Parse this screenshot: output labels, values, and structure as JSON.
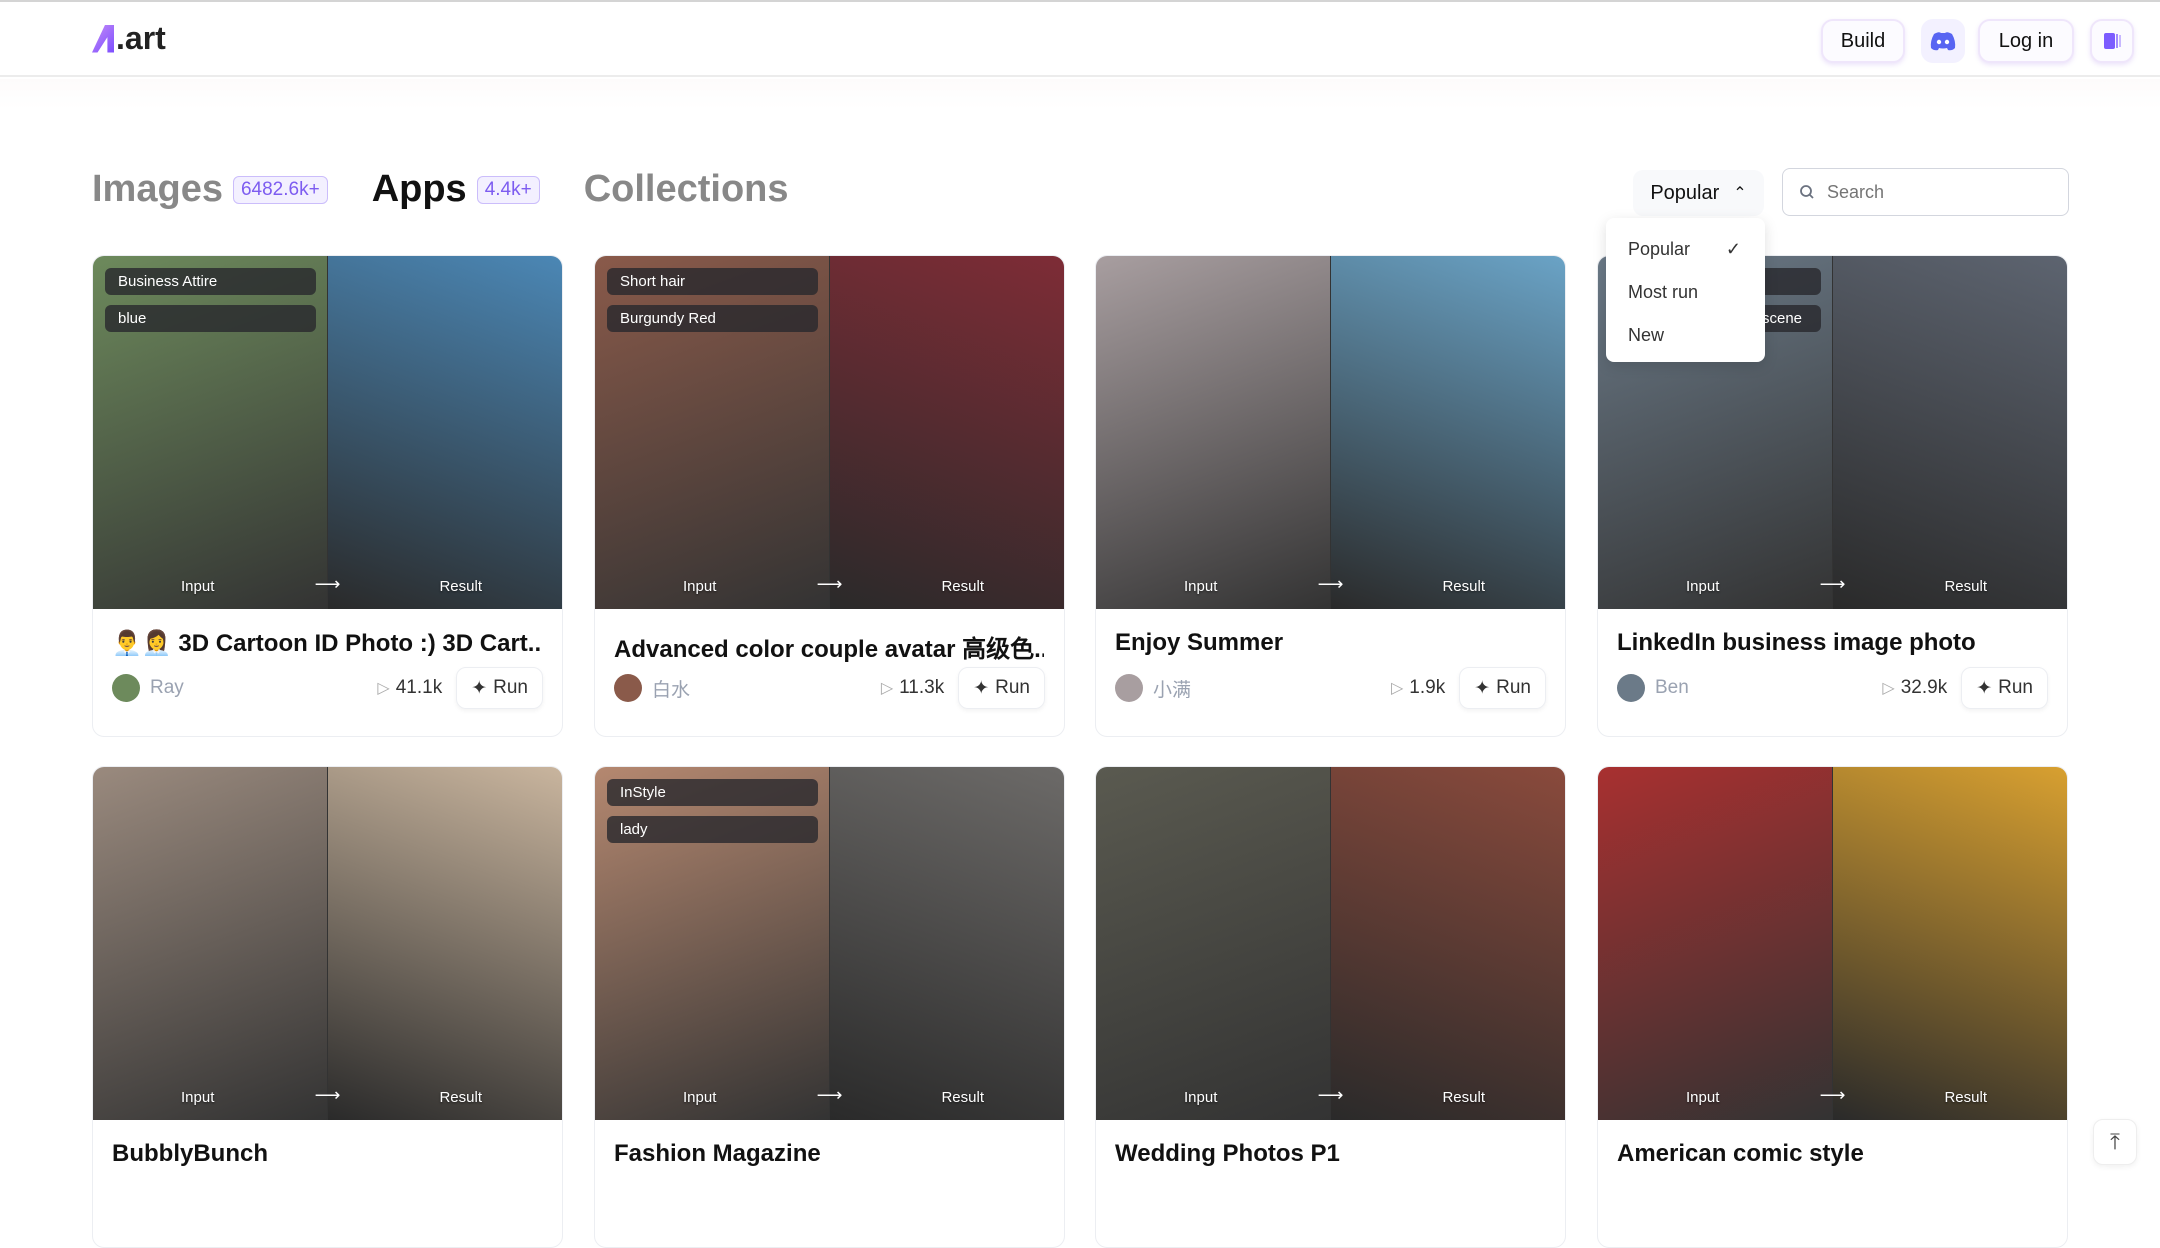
{
  "header": {
    "logo_text": ".art",
    "build_label": "Build",
    "login_label": "Log in",
    "discord_icon": "discord-icon",
    "apps_icon": "cards-icon"
  },
  "tabs": [
    {
      "label": "Images",
      "count": "6482.6k+"
    },
    {
      "label": "Apps",
      "count": "4.4k+",
      "active": true
    },
    {
      "label": "Collections"
    }
  ],
  "sort": {
    "selected": "Popular",
    "options": [
      "Popular",
      "Most run",
      "New"
    ]
  },
  "search": {
    "placeholder": "Search",
    "value": ""
  },
  "labels": {
    "input": "Input",
    "result": "Result",
    "run": "Run"
  },
  "cards": [
    {
      "title": "👨‍💼👩‍💼 3D Cartoon ID Photo :) 3D Cart...",
      "author": "Ray",
      "runs": "41.1k",
      "tags": [
        "Business Attire",
        "blue"
      ],
      "colors": [
        "#6d8a5c",
        "#4b87b5"
      ]
    },
    {
      "title": "Advanced color couple avatar 高级色...",
      "author": "白水",
      "runs": "11.3k",
      "tags": [
        "Short hair",
        "Burgundy Red"
      ],
      "colors": [
        "#8a5a4a",
        "#7e2c36"
      ]
    },
    {
      "title": "Enjoy Summer",
      "author": "小满",
      "runs": "1.9k",
      "tags": [],
      "colors": [
        "#a89ea0",
        "#6aa3c6"
      ]
    },
    {
      "title": "LinkedIn business image photo",
      "author": "Ben",
      "runs": "32.9k",
      "tags": [
        "+ Ligh  s silk ti",
        "Office building lobby scene"
      ],
      "colors": [
        "#6b7a88",
        "#5d6470"
      ]
    },
    {
      "title": "BubblyBunch",
      "author": "",
      "runs": "",
      "tags": [],
      "colors": [
        "#9a8a7e",
        "#c9b59e"
      ]
    },
    {
      "title": "Fashion Magazine",
      "author": "",
      "runs": "",
      "tags": [
        "InStyle",
        "lady"
      ],
      "colors": [
        "#b58870",
        "#6c6a68"
      ]
    },
    {
      "title": "Wedding Photos P1",
      "author": "",
      "runs": "",
      "tags": [],
      "colors": [
        "#5a5a50",
        "#8a4a3c"
      ]
    },
    {
      "title": "American comic style",
      "author": "",
      "runs": "",
      "tags": [],
      "colors": [
        "#a83030",
        "#d8a030"
      ]
    }
  ]
}
